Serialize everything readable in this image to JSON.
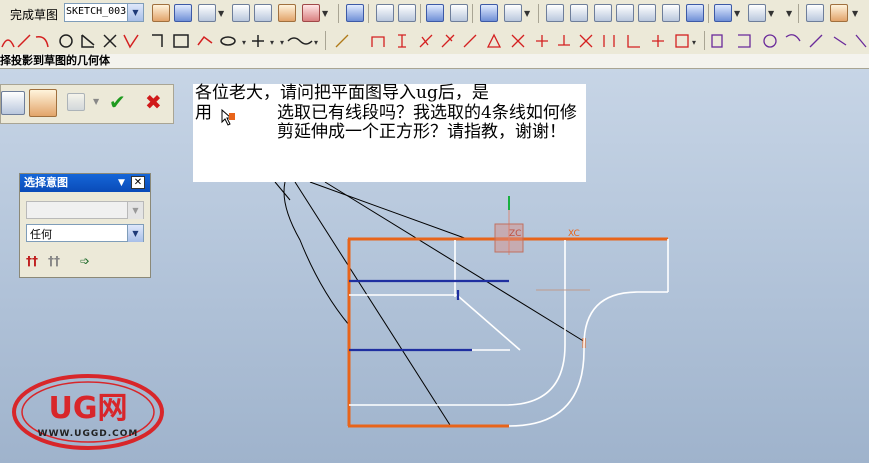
{
  "toolbar1": {
    "finish_sketch_label": "完成草图",
    "sketch_name": "SKETCH_003"
  },
  "toolbar3": {
    "title": "择投影到草图的几何体"
  },
  "question": {
    "line1": "各位老大，请问把平面图导入ug后，是",
    "line2_prefix": "用",
    "body": "选取已有线段吗？我选取的4条线如何修剪延伸成一个正方形？请指教，谢谢！"
  },
  "select_dialog": {
    "title": "选择意图",
    "field1_value": "",
    "field2_value": "任何"
  },
  "canvas": {
    "xc_label": "XC",
    "zc_label": "ZC"
  },
  "logo": {
    "text": "UG网",
    "url": "WWW.UGGD.COM"
  },
  "colors": {
    "orange": "#e8641a",
    "blue_line": "#1f2fa0",
    "white_line": "#ffffff",
    "viewport_top": "#c7d5e6",
    "logo_red": "#d8262a"
  }
}
